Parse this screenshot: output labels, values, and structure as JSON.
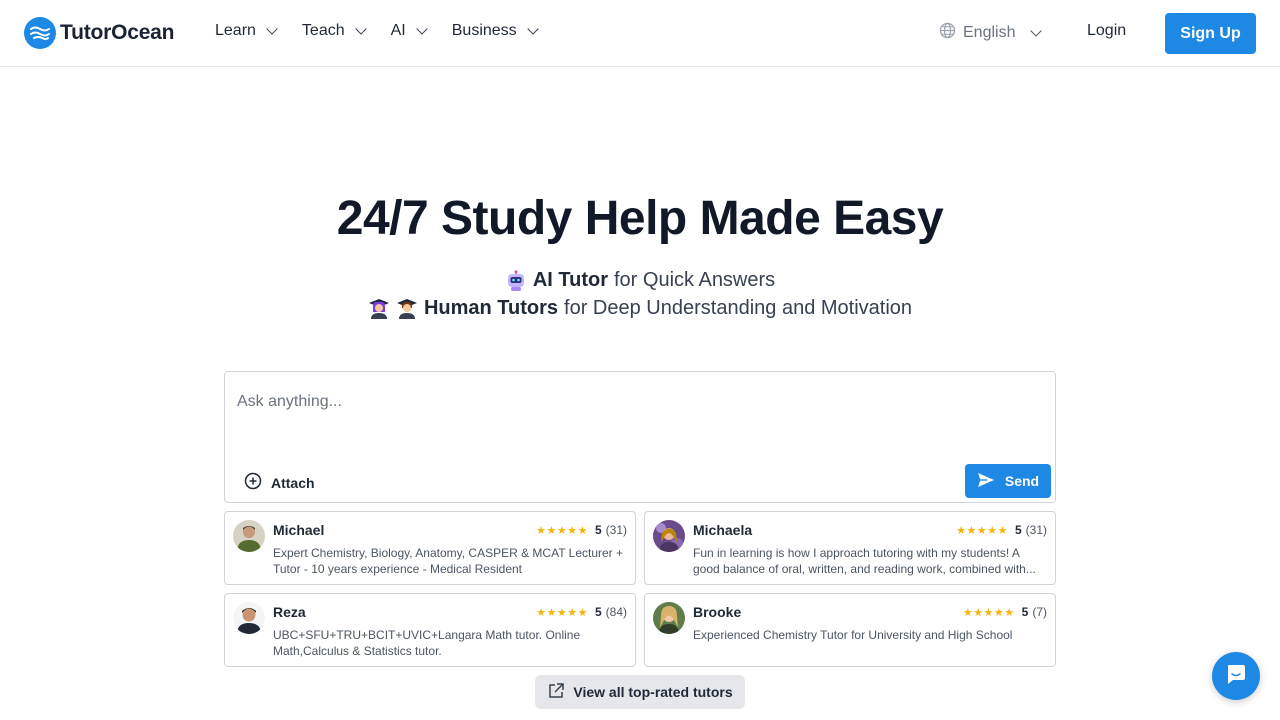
{
  "header": {
    "logo_text": "TutorOcean",
    "nav": [
      {
        "label": "Learn"
      },
      {
        "label": "Teach"
      },
      {
        "label": "AI"
      },
      {
        "label": "Business"
      }
    ],
    "language": "English",
    "login_label": "Login",
    "signup_label": "Sign Up"
  },
  "hero": {
    "title": "24/7 Study Help Made Easy",
    "line1_bold": "AI Tutor",
    "line1_rest": "for Quick Answers",
    "line2_bold": "Human Tutors",
    "line2_rest": "for Deep Understanding and Motivation"
  },
  "ask": {
    "placeholder": "Ask anything...",
    "attach_label": "Attach",
    "send_label": "Send"
  },
  "tutors": [
    {
      "name": "Michael",
      "stars": "★★★★★",
      "score": "5",
      "count": "(31)",
      "description": "Expert Chemistry, Biology, Anatomy, CASPER & MCAT Lecturer + Tutor - 10 years experience - Medical Resident"
    },
    {
      "name": "Michaela",
      "stars": "★★★★★",
      "score": "5",
      "count": "(31)",
      "description": "Fun in learning is how I approach tutoring with my students! A good balance of oral, written, and reading work, combined with..."
    },
    {
      "name": "Reza",
      "stars": "★★★★★",
      "score": "5",
      "count": "(84)",
      "description": "UBC+SFU+TRU+BCIT+UVIC+Langara Math tutor. Online Math,Calculus & Statistics tutor."
    },
    {
      "name": "Brooke",
      "stars": "★★★★★",
      "score": "5",
      "count": "(7)",
      "description": "Experienced Chemistry Tutor for University and High School"
    }
  ],
  "view_all_label": "View all top-rated tutors",
  "colors": {
    "brand": "#1e88e5",
    "star": "#f5b50a",
    "text": "#1f2937"
  },
  "icons": {
    "logo": "waves-icon",
    "language": "globe-icon",
    "attach": "plus-circle-icon",
    "send": "paper-plane-icon",
    "view_all": "external-link-icon",
    "chat": "chat-bubble-icon"
  }
}
